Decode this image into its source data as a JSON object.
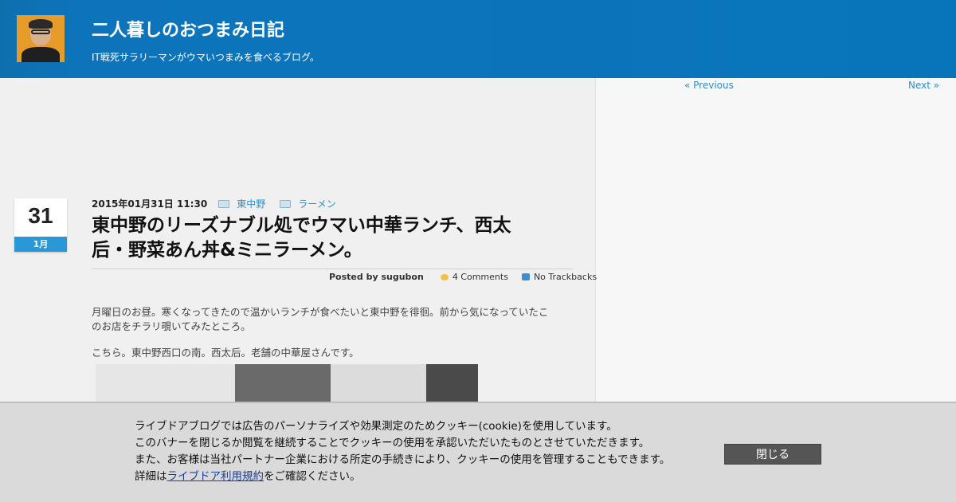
{
  "header": {
    "site_title": "二人暮しのおつまみ日記",
    "site_description": "IT戦死サラリーマンがウマいつまみを食べるブログ。"
  },
  "nav": {
    "previous": "« Previous",
    "next": "Next »"
  },
  "post": {
    "date_day": "31",
    "date_month": "1月",
    "datetime": "2015年01月31日 11:30",
    "categories": [
      "東中野",
      "ラーメン"
    ],
    "title_line1": "東中野のリーズナブル処でウマい中華ランチ、西太",
    "title_line2": "后・野菜あん丼&ミニラーメン。",
    "author": "Posted by sugubon",
    "comments": "4 Comments",
    "trackbacks": "No Trackbacks",
    "paragraph1_line1": "月曜日のお昼。寒くなってきたので温かいランチが食べたいと東中野を徘徊。前から気になっていたこ",
    "paragraph1_line2": "のお店をチラリ覗いてみたところ。",
    "paragraph2": "こちら。東中野西口の南。西太后。老舗の中華屋さんです。"
  },
  "cookie_banner": {
    "line1": "ライブドアブログでは広告のパーソナライズや効果測定のためクッキー(cookie)を使用しています。",
    "line2": "このバナーを閉じるか閲覧を継続することでクッキーの使用を承認いただいたものとさせていただきます。",
    "line3": "また、お客様は当社パートナー企業における所定の手続きにより、クッキーの使用を管理することもできます。",
    "line4_prefix": "詳細は",
    "line4_link": "ライブドア利用規約",
    "line4_suffix": "をご確認ください。",
    "close_label": "閉じる"
  },
  "colors": {
    "header_bg": "#0b73ba",
    "link": "#2a8fc9",
    "date_accent": "#2a97d6"
  }
}
